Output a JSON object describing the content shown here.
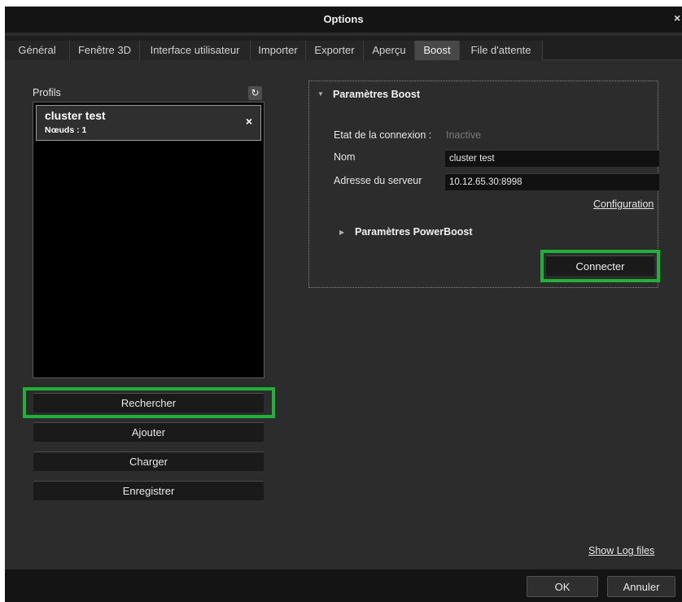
{
  "window": {
    "title": "Options",
    "close_glyph": "×"
  },
  "tabs": [
    {
      "label": "Général"
    },
    {
      "label": "Fenêtre 3D"
    },
    {
      "label": "Interface utilisateur"
    },
    {
      "label": "Importer"
    },
    {
      "label": "Exporter"
    },
    {
      "label": "Aperçu"
    },
    {
      "label": "Boost",
      "active": true
    },
    {
      "label": "File d'attente"
    }
  ],
  "profiles": {
    "label": "Profils",
    "refresh_icon": "refresh-icon",
    "items": [
      {
        "name": "cluster test",
        "nodes": "Nœuds : 1",
        "remove_glyph": "×"
      }
    ]
  },
  "buttons": {
    "search": "Rechercher",
    "add": "Ajouter",
    "load": "Charger",
    "save": "Enregistrer"
  },
  "boost": {
    "section_title": "Paramètres Boost",
    "connection_label": "Etat de la connexion :",
    "connection_value": "Inactive",
    "name_label": "Nom",
    "name_value": "cluster test",
    "server_label": "Adresse du serveur",
    "server_value": "10.12.65.30:8998",
    "config_link": "Configuration",
    "powerboost_title": "Paramètres PowerBoost",
    "connect_button": "Connecter"
  },
  "log_link": "Show Log files",
  "footer": {
    "ok": "OK",
    "cancel": "Annuler"
  },
  "colors": {
    "highlight": "#20b13b",
    "background": "#2c2c2c",
    "titlebar": "#141414"
  }
}
